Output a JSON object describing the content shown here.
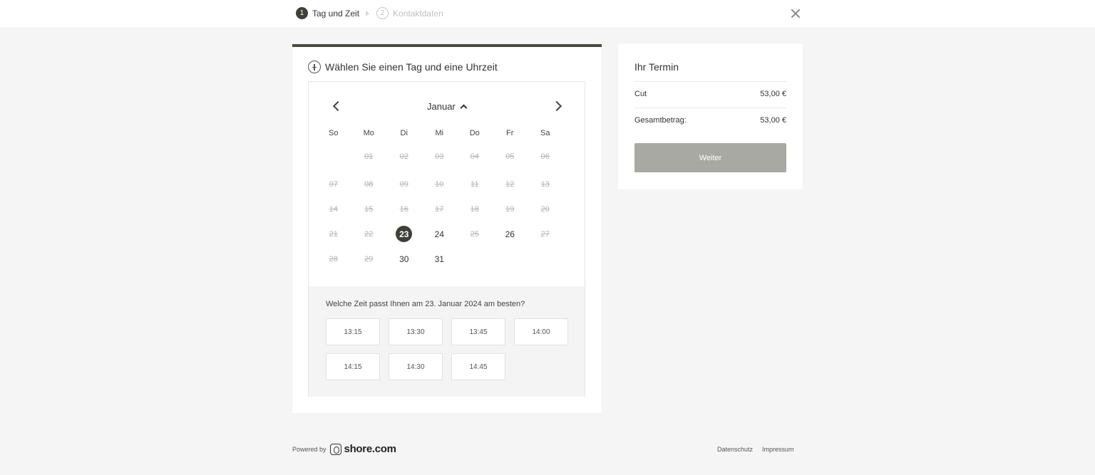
{
  "steps": [
    {
      "num": "1",
      "label": "Tag und Zeit",
      "active": true
    },
    {
      "num": "2",
      "label": "Kontaktdaten",
      "active": false
    }
  ],
  "calendar": {
    "title": "Wählen Sie einen Tag und eine Uhrzeit",
    "month": "Januar",
    "weekdays": [
      "So",
      "Mo",
      "Di",
      "Mi",
      "Do",
      "Fr",
      "Sa"
    ],
    "rows": [
      [
        null,
        {
          "d": "01",
          "s": "disabled"
        },
        {
          "d": "02",
          "s": "disabled"
        },
        {
          "d": "03",
          "s": "disabled"
        },
        {
          "d": "04",
          "s": "disabled"
        },
        {
          "d": "05",
          "s": "disabled"
        },
        {
          "d": "06",
          "s": "disabled"
        }
      ],
      [
        {
          "d": "07",
          "s": "disabled"
        },
        {
          "d": "08",
          "s": "disabled"
        },
        {
          "d": "09",
          "s": "disabled"
        },
        {
          "d": "10",
          "s": "disabled"
        },
        {
          "d": "11",
          "s": "disabled"
        },
        {
          "d": "12",
          "s": "disabled"
        },
        {
          "d": "13",
          "s": "disabled"
        }
      ],
      [
        {
          "d": "14",
          "s": "disabled"
        },
        {
          "d": "15",
          "s": "disabled"
        },
        {
          "d": "16",
          "s": "disabled"
        },
        {
          "d": "17",
          "s": "disabled"
        },
        {
          "d": "18",
          "s": "disabled"
        },
        {
          "d": "19",
          "s": "disabled"
        },
        {
          "d": "20",
          "s": "disabled"
        }
      ],
      [
        {
          "d": "21",
          "s": "disabled"
        },
        {
          "d": "22",
          "s": "disabled"
        },
        {
          "d": "23",
          "s": "selected"
        },
        {
          "d": "24",
          "s": "available"
        },
        {
          "d": "25",
          "s": "disabled"
        },
        {
          "d": "26",
          "s": "available"
        },
        {
          "d": "27",
          "s": "disabled"
        }
      ],
      [
        {
          "d": "28",
          "s": "disabled"
        },
        {
          "d": "29",
          "s": "disabled"
        },
        {
          "d": "30",
          "s": "available"
        },
        {
          "d": "31",
          "s": "available"
        },
        null,
        null,
        null
      ]
    ]
  },
  "times": {
    "question": "Welche Zeit passt Ihnen am 23. Januar 2024 am besten?",
    "slots": [
      "13:15",
      "13:30",
      "13:45",
      "14:00",
      "14:15",
      "14:30",
      "14:45"
    ]
  },
  "summary": {
    "title": "Ihr Termin",
    "service": "Cut",
    "service_price": "53,00 €",
    "total_label": "Gesamtbetrag:",
    "total_price": "53,00 €",
    "button": "Weiter"
  },
  "footer": {
    "powered_by": "Powered by",
    "logo": "shore.com",
    "links": [
      "Datenschutz",
      "Impressum"
    ]
  },
  "colors": {
    "accent": "#3f3f37",
    "button_disabled": "#a9a9a3",
    "background": "#f5f5f5"
  }
}
